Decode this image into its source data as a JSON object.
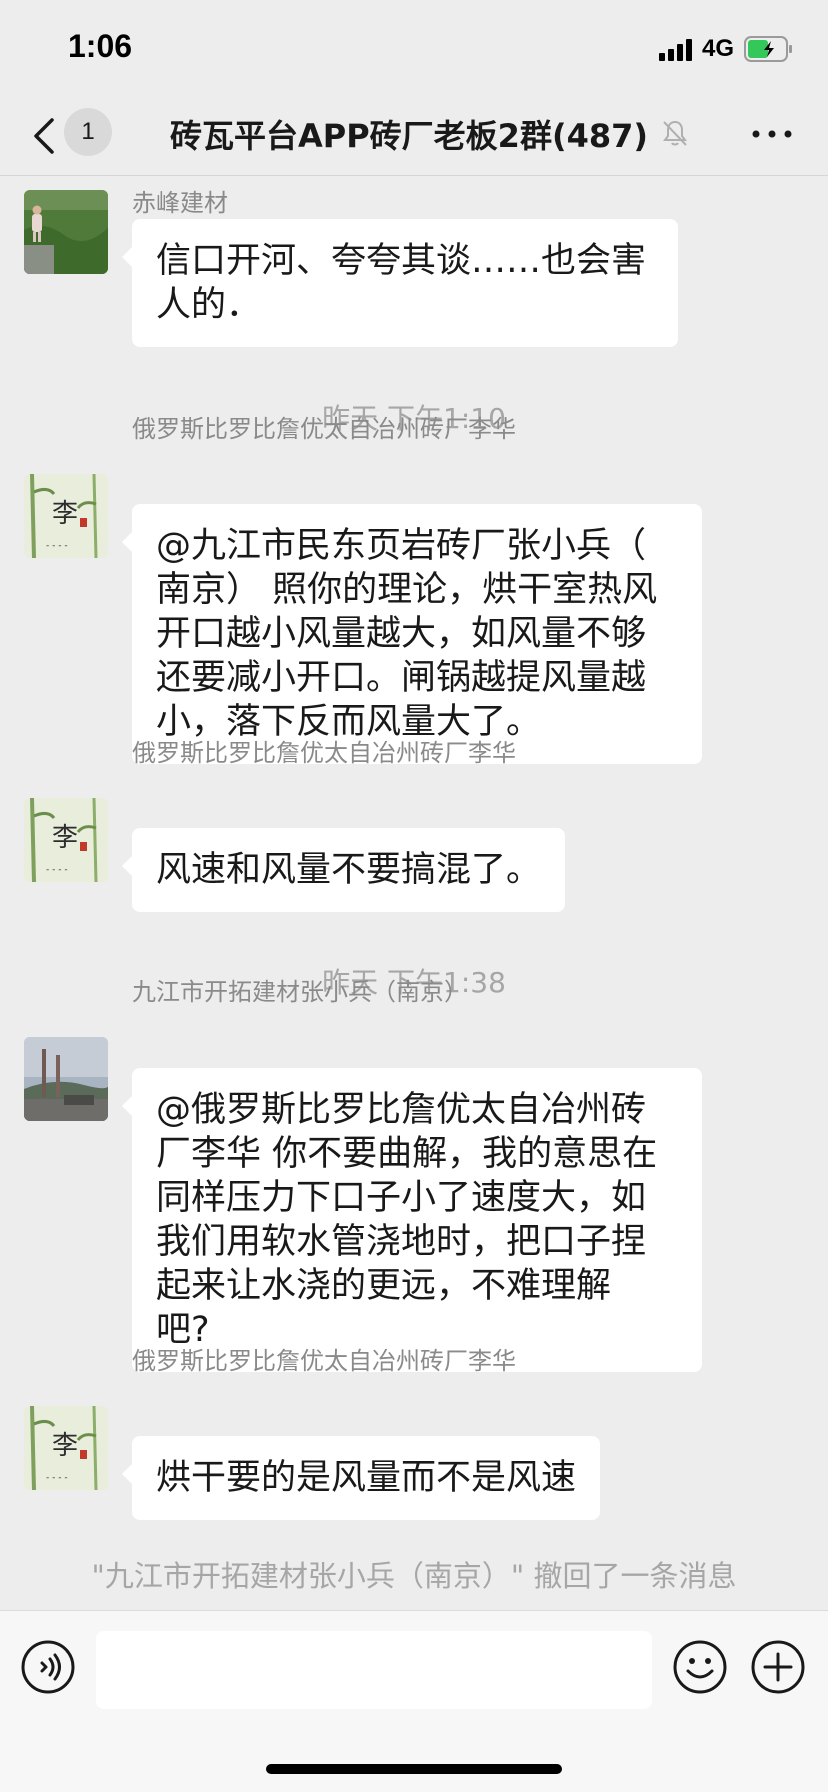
{
  "status_bar": {
    "time": "1:06",
    "network": "4G",
    "battery_color": "#34c759"
  },
  "header": {
    "unread_count": "1",
    "title": "砖瓦平台APP砖厂老板2群(487)",
    "icons": [
      "back-arrow-icon",
      "mute-bell-icon",
      "more-icon"
    ]
  },
  "messages": [
    {
      "sender": "赤峰建材",
      "text": "信口开河、夸夸其谈……也会害\n人的．",
      "avatar": "child-in-field-photo"
    },
    {
      "timestamp": "昨天 下午1:10"
    },
    {
      "sender": "俄罗斯比罗比詹优太自冶州砖厂李华",
      "text": "@九江市民东页岩砖厂张小兵（\n南京） 照你的理论，烘干室热风\n开口越小风量越大，如风量不够\n还要减小开口。闸锅越提风量越\n小，落下反而风量大了。",
      "avatar": "bamboo-li-painting"
    },
    {
      "sender": "俄罗斯比罗比詹优太自冶州砖厂李华",
      "text": "风速和风量不要搞混了。",
      "avatar": "bamboo-li-painting"
    },
    {
      "timestamp": "昨天 下午1:38"
    },
    {
      "sender": "九江市开拓建材张小兵（南京）",
      "text": "@俄罗斯比罗比詹优太自冶州砖\n厂李华 你不要曲解，我的意思在\n同样压力下口子小了速度大，如\n我们用软水管浇地时，把口子捏\n起来让水浇的更远，不难理解\n吧?",
      "avatar": "factory-chimney-photo"
    },
    {
      "sender": "俄罗斯比罗比詹优太自冶州砖厂李华",
      "text": "烘干要的是风量而不是风速",
      "avatar": "bamboo-li-painting"
    },
    {
      "system_note": "\"九江市开拓建材张小兵（南京）\" 撤回了一条消息"
    }
  ],
  "input_bar": {
    "text_value": "",
    "icons": [
      "voice-icon",
      "emoji-icon",
      "plus-icon"
    ]
  }
}
